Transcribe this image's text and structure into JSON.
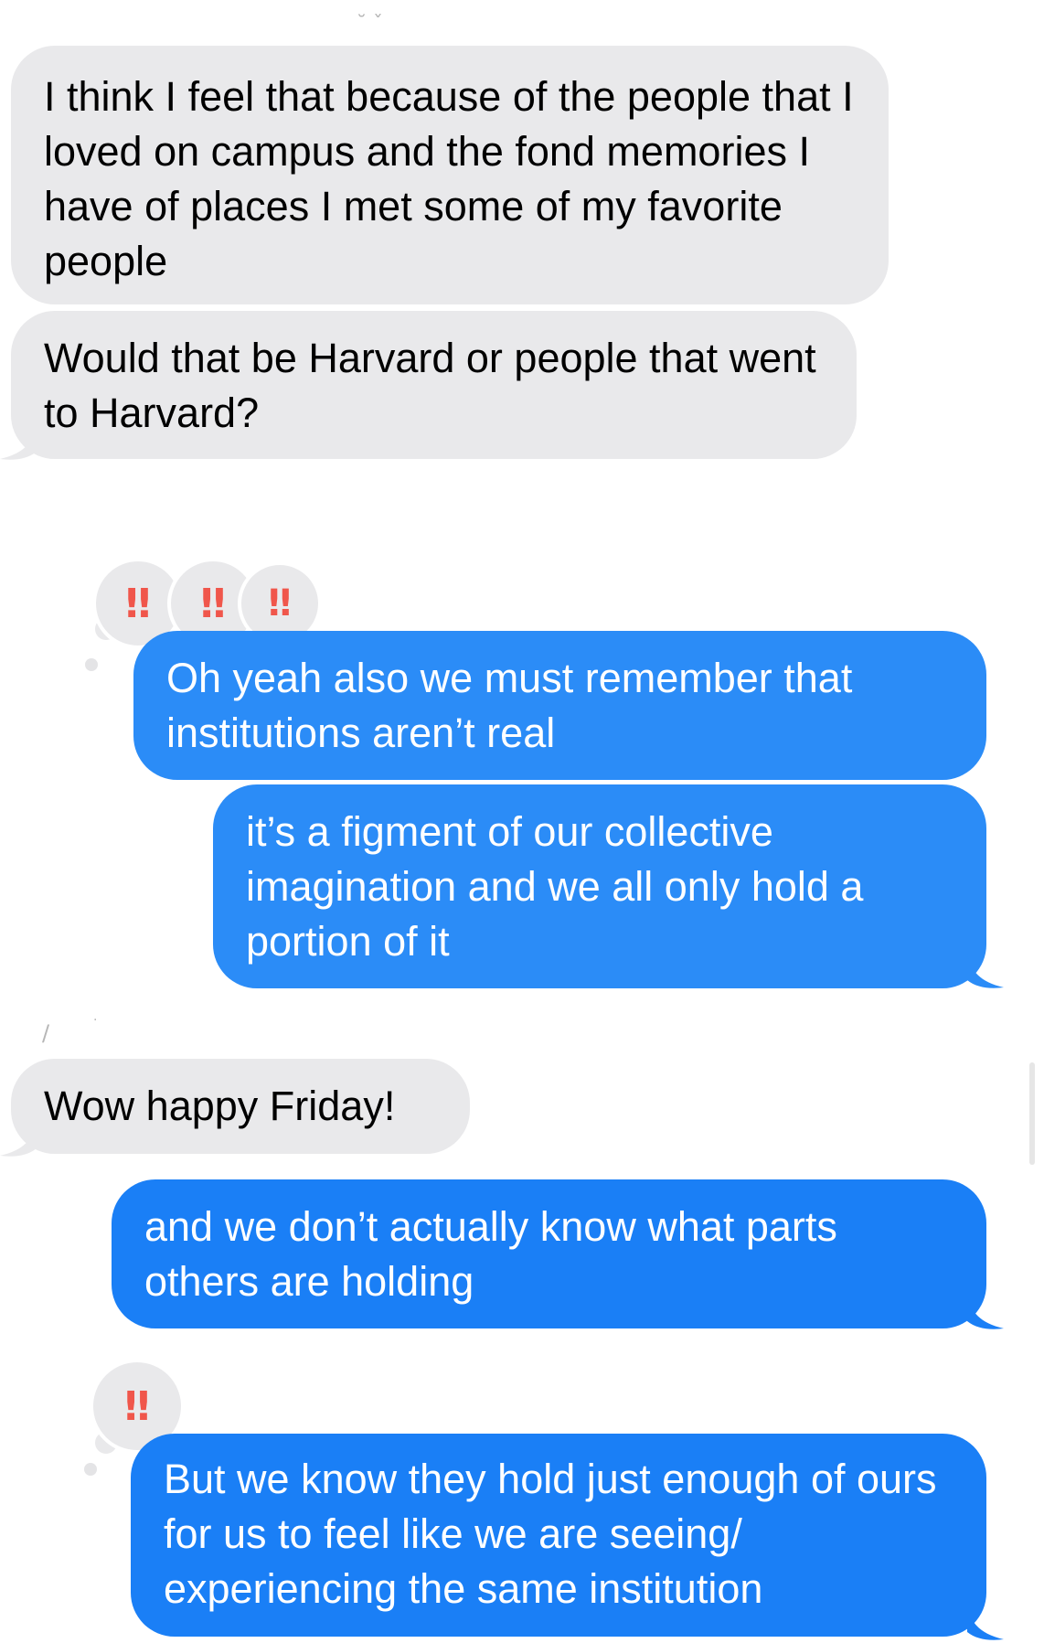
{
  "messages": [
    {
      "id": "m1",
      "direction": "received",
      "text": "I think I feel that because of the people that I loved on campus and the fond memories I have of places I met some of my favorite people"
    },
    {
      "id": "m2",
      "direction": "received",
      "text": "Would that be Harvard or people that went to Harvard?"
    },
    {
      "id": "m3",
      "direction": "sent",
      "text": "Oh yeah also we must remember that institutions aren’t real",
      "reactions": [
        "‼",
        "‼",
        "‼"
      ]
    },
    {
      "id": "m4",
      "direction": "sent",
      "text": "it’s a figment of our collective imagination and we all only hold a portion of it"
    },
    {
      "id": "m5",
      "direction": "received",
      "text": "Wow happy Friday!"
    },
    {
      "id": "m6",
      "direction": "sent",
      "text": "and we don’t actually know what parts others are holding"
    },
    {
      "id": "m7",
      "direction": "sent",
      "text": "But we know they hold just enough of ours for us to feel like we are seeing/ experiencing the same institution",
      "reactions": [
        "‼"
      ]
    }
  ],
  "colors": {
    "received_bubble": "#e9e9eb",
    "sent_bubble": "#2b8cf7",
    "reaction_icon": "#f0564b"
  },
  "icons": {
    "reaction": "double-exclamation-icon"
  }
}
